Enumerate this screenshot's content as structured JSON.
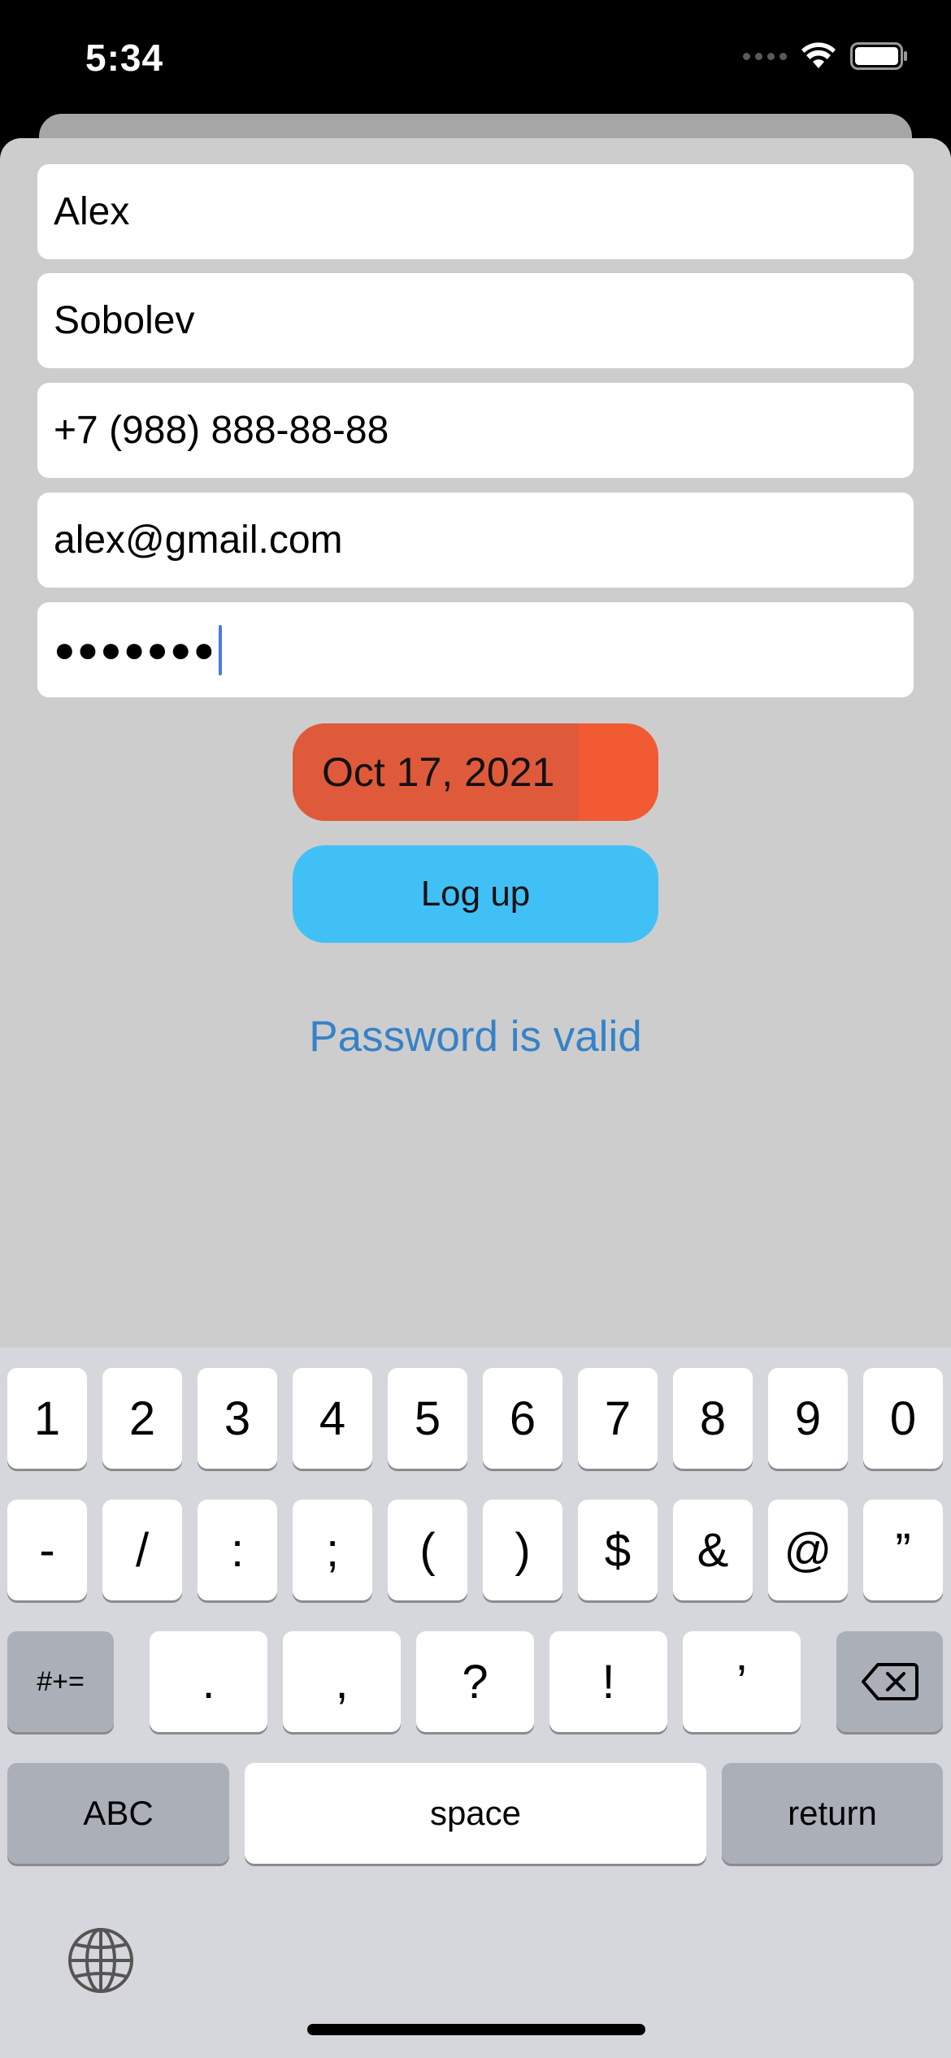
{
  "status_bar": {
    "time": "5:34"
  },
  "form": {
    "first_name": "Alex",
    "last_name": "Sobolev",
    "phone": "+7 (988) 888-88-88",
    "email": "alex@gmail.com",
    "password_mask": "●●●●●●●",
    "date": "Oct 17, 2021",
    "logup_label": "Log up",
    "status_message": "Password is valid"
  },
  "keyboard": {
    "row1": [
      "1",
      "2",
      "3",
      "4",
      "5",
      "6",
      "7",
      "8",
      "9",
      "0"
    ],
    "row2": [
      "-",
      "/",
      ":",
      ";",
      "(",
      ")",
      "$",
      "&",
      "@",
      "”"
    ],
    "row3": [
      ".",
      ",",
      "?",
      "!",
      "’"
    ],
    "more_symbols": "#+=",
    "abc": "ABC",
    "space": "space",
    "return": "return"
  },
  "colors": {
    "date_button": "#f15a33",
    "logup_button": "#41c0f6",
    "status_text": "#3682c8",
    "sheet": "#cdcdcd"
  }
}
